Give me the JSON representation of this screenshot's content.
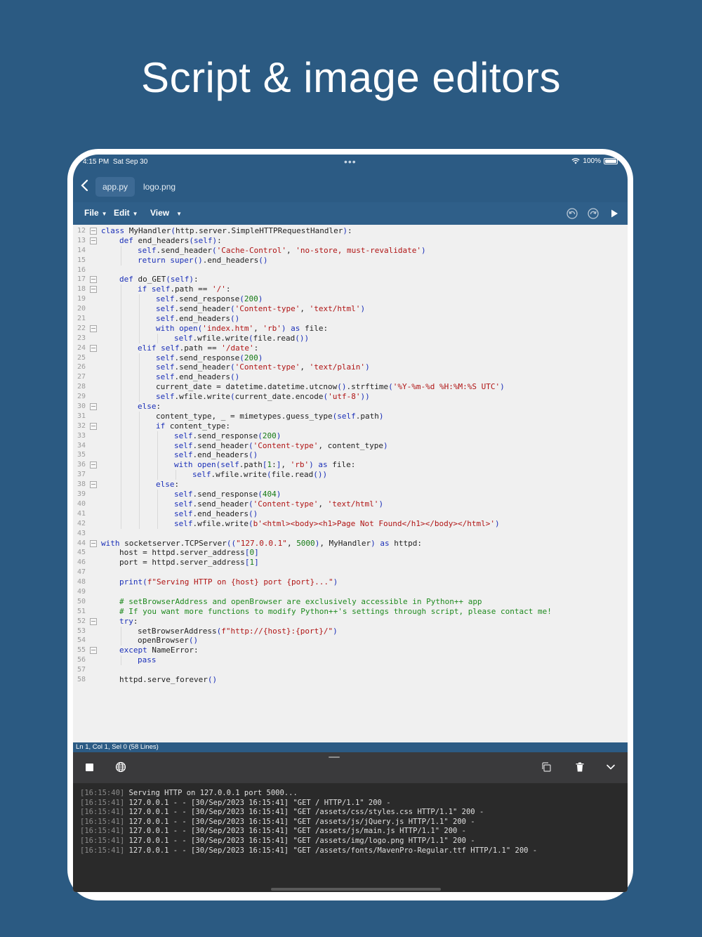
{
  "headline": "Script & image editors",
  "status": {
    "time": "4:15 PM",
    "date": "Sat Sep 30",
    "battery": "100%"
  },
  "tabs": [
    {
      "label": "app.py",
      "active": true
    },
    {
      "label": "logo.png",
      "active": false
    }
  ],
  "menus": [
    "File",
    "Edit",
    "View"
  ],
  "caret": "▼",
  "editor": {
    "status_line": "Ln 1, Col 1, Sel 0 (58 Lines)",
    "lines": [
      {
        "n": "12",
        "fold": true,
        "indent": 0,
        "text": "class MyHandler(http.server.SimpleHTTPRequestHandler):"
      },
      {
        "n": "13",
        "fold": true,
        "indent": 1,
        "text": "def end_headers(self):"
      },
      {
        "n": "14",
        "fold": false,
        "indent": 2,
        "text": "self.send_header('Cache-Control', 'no-store, must-revalidate')"
      },
      {
        "n": "15",
        "fold": false,
        "indent": 2,
        "text": "return super().end_headers()"
      },
      {
        "n": "16",
        "fold": false,
        "indent": 0,
        "text": ""
      },
      {
        "n": "17",
        "fold": true,
        "indent": 1,
        "text": "def do_GET(self):"
      },
      {
        "n": "18",
        "fold": true,
        "indent": 2,
        "text": "if self.path == '/':"
      },
      {
        "n": "19",
        "fold": false,
        "indent": 3,
        "text": "self.send_response(200)"
      },
      {
        "n": "20",
        "fold": false,
        "indent": 3,
        "text": "self.send_header('Content-type', 'text/html')"
      },
      {
        "n": "21",
        "fold": false,
        "indent": 3,
        "text": "self.end_headers()"
      },
      {
        "n": "22",
        "fold": true,
        "indent": 3,
        "text": "with open('index.htm', 'rb') as file:"
      },
      {
        "n": "23",
        "fold": false,
        "indent": 4,
        "text": "self.wfile.write(file.read())"
      },
      {
        "n": "24",
        "fold": true,
        "indent": 2,
        "text": "elif self.path == '/date':"
      },
      {
        "n": "25",
        "fold": false,
        "indent": 3,
        "text": "self.send_response(200)"
      },
      {
        "n": "26",
        "fold": false,
        "indent": 3,
        "text": "self.send_header('Content-type', 'text/plain')"
      },
      {
        "n": "27",
        "fold": false,
        "indent": 3,
        "text": "self.end_headers()"
      },
      {
        "n": "28",
        "fold": false,
        "indent": 3,
        "text": "current_date = datetime.datetime.utcnow().strftime('%Y-%m-%d %H:%M:%S UTC')"
      },
      {
        "n": "29",
        "fold": false,
        "indent": 3,
        "text": "self.wfile.write(current_date.encode('utf-8'))"
      },
      {
        "n": "30",
        "fold": true,
        "indent": 2,
        "text": "else:"
      },
      {
        "n": "31",
        "fold": false,
        "indent": 3,
        "text": "content_type, _ = mimetypes.guess_type(self.path)"
      },
      {
        "n": "32",
        "fold": true,
        "indent": 3,
        "text": "if content_type:"
      },
      {
        "n": "33",
        "fold": false,
        "indent": 4,
        "text": "self.send_response(200)"
      },
      {
        "n": "34",
        "fold": false,
        "indent": 4,
        "text": "self.send_header('Content-type', content_type)"
      },
      {
        "n": "35",
        "fold": false,
        "indent": 4,
        "text": "self.end_headers()"
      },
      {
        "n": "36",
        "fold": true,
        "indent": 4,
        "text": "with open(self.path[1:], 'rb') as file:"
      },
      {
        "n": "37",
        "fold": false,
        "indent": 5,
        "text": "self.wfile.write(file.read())"
      },
      {
        "n": "38",
        "fold": true,
        "indent": 3,
        "text": "else:"
      },
      {
        "n": "39",
        "fold": false,
        "indent": 4,
        "text": "self.send_response(404)"
      },
      {
        "n": "40",
        "fold": false,
        "indent": 4,
        "text": "self.send_header('Content-type', 'text/html')"
      },
      {
        "n": "41",
        "fold": false,
        "indent": 4,
        "text": "self.end_headers()"
      },
      {
        "n": "42",
        "fold": false,
        "indent": 4,
        "text": "self.wfile.write(b'<html><body><h1>Page Not Found</h1></body></html>')"
      },
      {
        "n": "43",
        "fold": false,
        "indent": 0,
        "text": ""
      },
      {
        "n": "44",
        "fold": true,
        "indent": 0,
        "text": "with socketserver.TCPServer((\"127.0.0.1\", 5000), MyHandler) as httpd:"
      },
      {
        "n": "45",
        "fold": false,
        "indent": 1,
        "text": "host = httpd.server_address[0]"
      },
      {
        "n": "46",
        "fold": false,
        "indent": 1,
        "text": "port = httpd.server_address[1]"
      },
      {
        "n": "47",
        "fold": false,
        "indent": 0,
        "text": ""
      },
      {
        "n": "48",
        "fold": false,
        "indent": 1,
        "text": "print(f\"Serving HTTP on {host} port {port}...\")"
      },
      {
        "n": "49",
        "fold": false,
        "indent": 0,
        "text": ""
      },
      {
        "n": "50",
        "fold": false,
        "indent": 1,
        "text": "# setBrowserAddress and openBrowser are exclusively accessible in Python++ app"
      },
      {
        "n": "51",
        "fold": false,
        "indent": 1,
        "text": "# If you want more functions to modify Python++'s settings through script, please contact me!"
      },
      {
        "n": "52",
        "fold": true,
        "indent": 1,
        "text": "try:"
      },
      {
        "n": "53",
        "fold": false,
        "indent": 2,
        "text": "setBrowserAddress(f\"http://{host}:{port}/\")"
      },
      {
        "n": "54",
        "fold": false,
        "indent": 2,
        "text": "openBrowser()"
      },
      {
        "n": "55",
        "fold": true,
        "indent": 1,
        "text": "except NameError:"
      },
      {
        "n": "56",
        "fold": false,
        "indent": 2,
        "text": "pass"
      },
      {
        "n": "57",
        "fold": false,
        "indent": 0,
        "text": ""
      },
      {
        "n": "58",
        "fold": false,
        "indent": 1,
        "text": "httpd.serve_forever()"
      }
    ]
  },
  "console": {
    "lines": [
      {
        "ts": "[16:15:40]",
        "msg": "Serving HTTP on 127.0.0.1 port 5000..."
      },
      {
        "ts": "[16:15:41]",
        "msg": "127.0.0.1 - - [30/Sep/2023 16:15:41] \"GET / HTTP/1.1\" 200 -"
      },
      {
        "ts": "[16:15:41]",
        "msg": "127.0.0.1 - - [30/Sep/2023 16:15:41] \"GET /assets/css/styles.css HTTP/1.1\" 200 -"
      },
      {
        "ts": "[16:15:41]",
        "msg": "127.0.0.1 - - [30/Sep/2023 16:15:41] \"GET /assets/js/jQuery.js HTTP/1.1\" 200 -"
      },
      {
        "ts": "[16:15:41]",
        "msg": "127.0.0.1 - - [30/Sep/2023 16:15:41] \"GET /assets/js/main.js HTTP/1.1\" 200 -"
      },
      {
        "ts": "[16:15:41]",
        "msg": "127.0.0.1 - - [30/Sep/2023 16:15:41] \"GET /assets/img/logo.png HTTP/1.1\" 200 -"
      },
      {
        "ts": "[16:15:41]",
        "msg": "127.0.0.1 - - [30/Sep/2023 16:15:41] \"GET /assets/fonts/MavenPro-Regular.ttf HTTP/1.1\" 200 -"
      }
    ]
  },
  "colors": {
    "background": "#2b5a82",
    "toolbar": "#2f5f89",
    "console": "#2a2a2a",
    "keyword": "#1a2fb8",
    "string": "#b01414",
    "comment": "#1f8a1f"
  }
}
